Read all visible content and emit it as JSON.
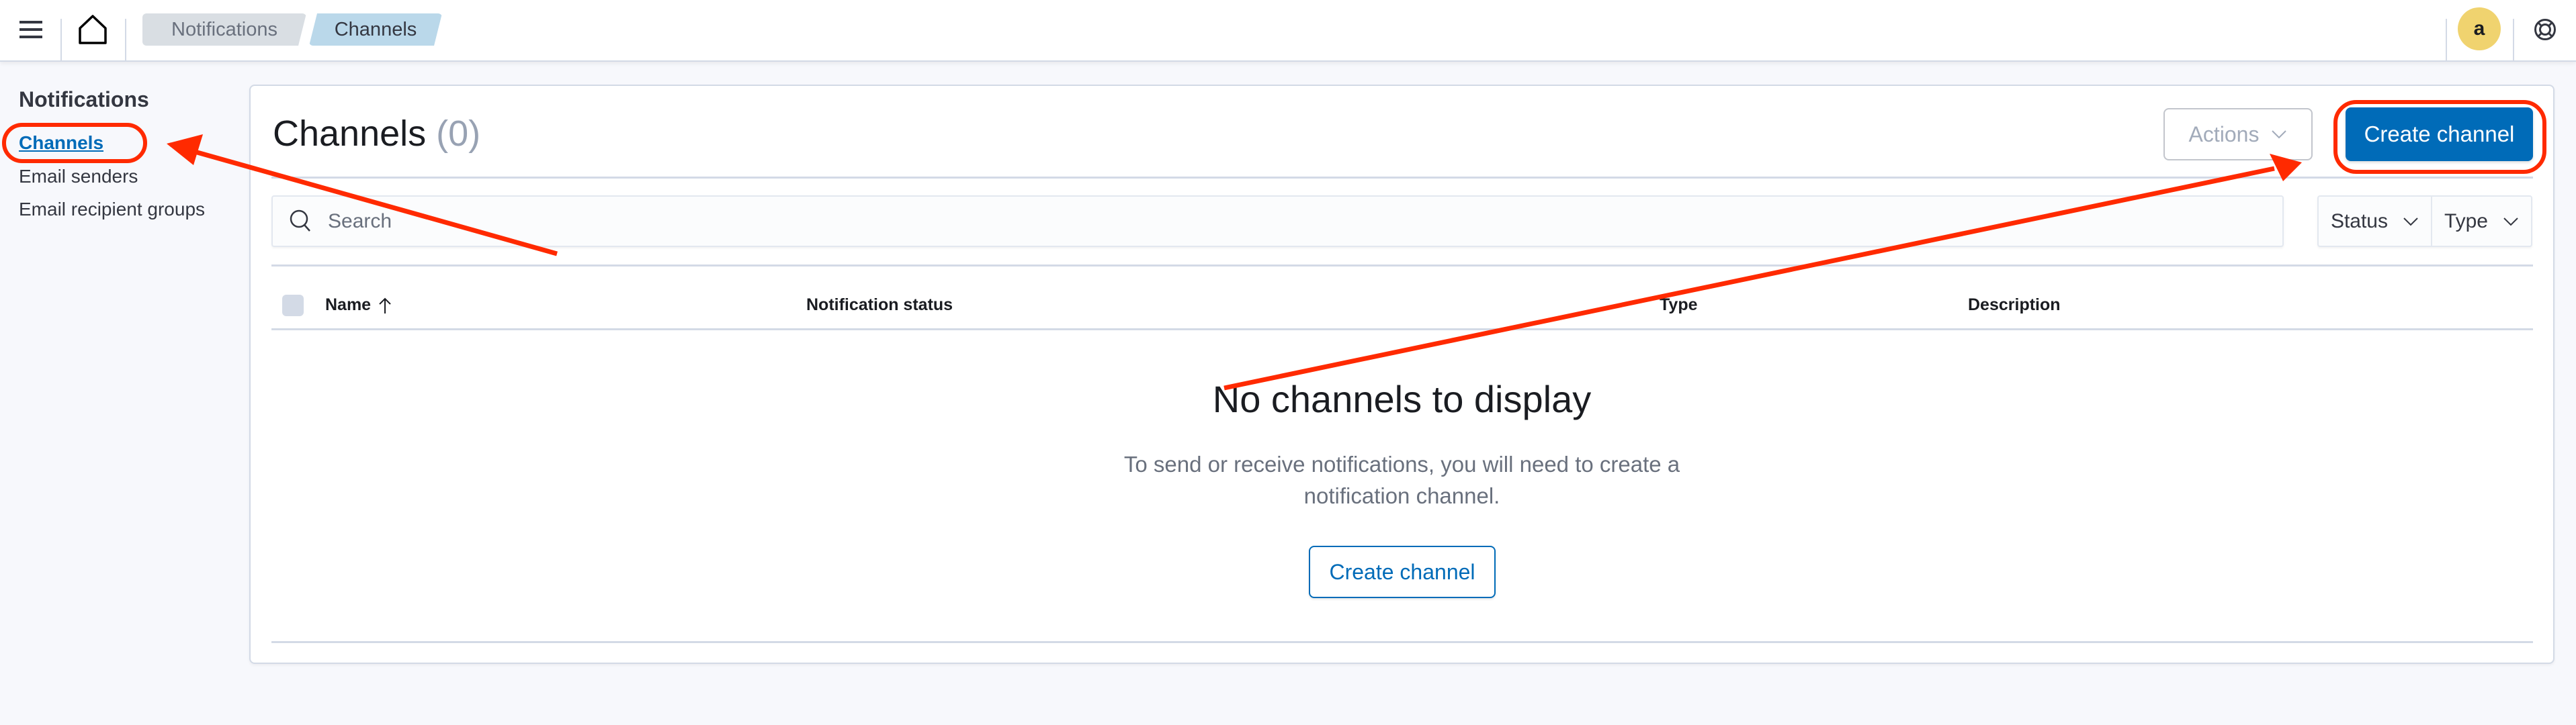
{
  "header": {
    "menu_icon": "hamburger-menu-icon",
    "home_icon": "home-icon",
    "breadcrumbs": [
      {
        "label": "Notifications"
      },
      {
        "label": "Channels"
      }
    ],
    "avatar_initial": "a",
    "help_icon": "help-lifebuoy-icon"
  },
  "sidebar": {
    "title": "Notifications",
    "items": [
      {
        "label": "Channels",
        "active": true
      },
      {
        "label": "Email senders",
        "active": false
      },
      {
        "label": "Email recipient groups",
        "active": false
      }
    ]
  },
  "main": {
    "title": "Channels",
    "count": "(0)",
    "actions_label": "Actions",
    "create_label": "Create channel",
    "search_placeholder": "Search",
    "search_value": "",
    "filters": [
      {
        "label": "Status"
      },
      {
        "label": "Type"
      }
    ],
    "table": {
      "columns": [
        {
          "label": "Name",
          "sort": "ascending"
        },
        {
          "label": "Notification status"
        },
        {
          "label": "Type"
        },
        {
          "label": "Description"
        }
      ],
      "rows": []
    },
    "empty_state": {
      "title": "No channels to display",
      "body": "To send or receive notifications, you will need to create a notification channel.",
      "button_label": "Create channel"
    }
  },
  "annotations": {
    "color": "#ff2a00",
    "highlighted": [
      "sidebar-item-channels",
      "create-channel-button"
    ]
  },
  "colors": {
    "primary": "#006bb8",
    "breadcrumb_active_bg": "#bad8ea",
    "avatar_bg": "#f0d36f"
  }
}
